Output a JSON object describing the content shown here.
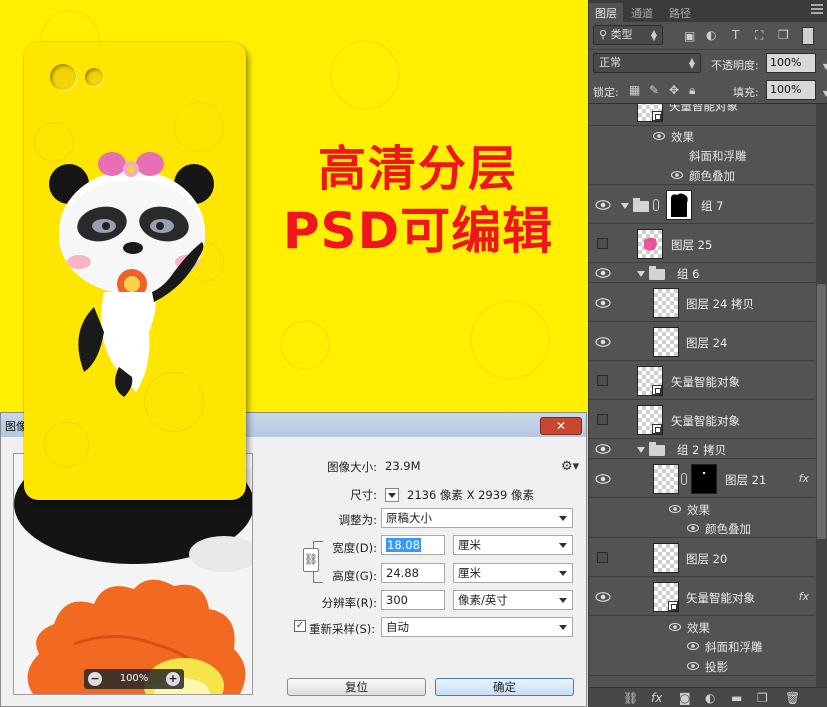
{
  "banner": {
    "line1": "高清分层",
    "line2": "PSD可编辑"
  },
  "dialog": {
    "title": "图像",
    "close_label": "✕",
    "zoom": "100%",
    "image_size_label": "图像大小:",
    "image_size_value": "23.9M",
    "dimensions_label": "尺寸:",
    "dimensions_value": "2136 像素  X  2939 像素",
    "fit_label": "调整为:",
    "fit_value": "原稿大小",
    "width_label": "宽度(D):",
    "width_value": "18.08",
    "width_unit": "厘米",
    "height_label": "高度(G):",
    "height_value": "24.88",
    "height_unit": "厘米",
    "resolution_label": "分辨率(R):",
    "resolution_value": "300",
    "resolution_unit": "像素/英寸",
    "resample_label": "重新采样(S):",
    "resample_value": "自动",
    "reset_label": "复位",
    "ok_label": "确定"
  },
  "layers_panel": {
    "tabs": [
      "图层",
      "通道",
      "路径"
    ],
    "filter_kind": "类型",
    "blend_mode": "正常",
    "opacity_label": "不透明度:",
    "opacity_value": "100%",
    "lock_label": "锁定:",
    "fill_label": "填充:",
    "fill_value": "100%",
    "partial_top": "矢量智能对象",
    "rows": {
      "effects_a": "效果",
      "bevel_a": "斜面和浮雕",
      "overlay_a": "颜色叠加",
      "group7": "组 7",
      "layer25": "图层 25",
      "group6": "组 6",
      "layer24copy": "图层 24 拷贝",
      "layer24": "图层 24",
      "smart1": "矢量智能对象",
      "smart2": "矢量智能对象",
      "group2copy": "组 2 拷贝",
      "layer21": "图层 21",
      "effects_b": "效果",
      "overlay_b": "颜色叠加",
      "layer20": "图层 20",
      "smart3": "矢量智能对象",
      "effects_c": "效果",
      "bevel_c": "斜面和浮雕",
      "shadow_c": "投影"
    },
    "fx_mark": "fx"
  }
}
